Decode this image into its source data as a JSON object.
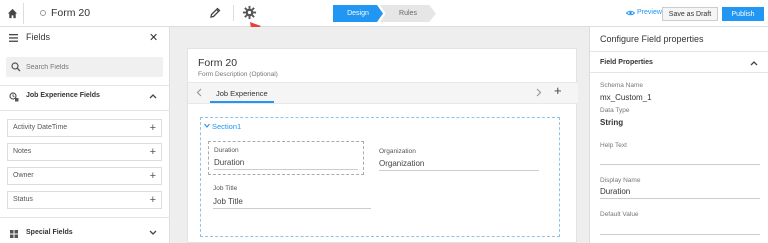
{
  "header": {
    "title": "Form 20",
    "tabs": [
      {
        "label": "Design",
        "active": true
      },
      {
        "label": "Rules",
        "active": false
      }
    ],
    "preview_label": "Preview",
    "save_draft_label": "Save as Draft",
    "publish_label": "Publish",
    "accent_color": "#2196f3"
  },
  "sidebar": {
    "title": "Fields",
    "search_placeholder": "Search Fields",
    "categories": [
      {
        "label": "Job Experience Fields",
        "expanded": true,
        "items": [
          {
            "label": "Activity DateTime"
          },
          {
            "label": "Notes"
          },
          {
            "label": "Owner"
          },
          {
            "label": "Status"
          }
        ]
      },
      {
        "label": "Special Fields",
        "expanded": false
      }
    ]
  },
  "form": {
    "title": "Form 20",
    "description": "Form Description (Optional)",
    "tab": "Job Experience",
    "section": {
      "title": "Section1",
      "fields": [
        {
          "label": "Duration",
          "placeholder": "Duration",
          "selected": true
        },
        {
          "label": "Organization",
          "placeholder": "Organization",
          "selected": false
        },
        {
          "label": "Job Title",
          "placeholder": "Job Title",
          "selected": false
        }
      ]
    }
  },
  "properties": {
    "title": "Configure Field properties",
    "section_label": "Field Properties",
    "schema_name_label": "Schema Name",
    "schema_name": "mx_Custom_1",
    "data_type_label": "Data Type",
    "data_type": "String",
    "help_text_label": "Help Text",
    "help_text": "",
    "display_name_label": "Display Name",
    "display_name": "Duration",
    "default_value_label": "Default Value",
    "default_value": ""
  }
}
